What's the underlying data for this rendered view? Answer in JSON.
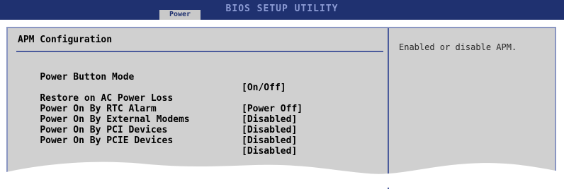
{
  "header": {
    "title": "BIOS SETUP UTILITY",
    "active_tab": "Power"
  },
  "main": {
    "section_title": "APM Configuration",
    "items": [
      {
        "label": "Power Button Mode",
        "value": "[On/Off]"
      },
      {
        "label": "Restore on AC Power Loss",
        "value": "[Power Off]"
      },
      {
        "label": "Power On By RTC Alarm",
        "value": "[Disabled]"
      },
      {
        "label": "Power On By External Modems",
        "value": "[Disabled]"
      },
      {
        "label": "Power On By PCI Devices",
        "value": "[Disabled]"
      },
      {
        "label": "Power On By PCIE Devices",
        "value": "[Disabled]"
      }
    ]
  },
  "help": {
    "text": "Enabled or disable APM."
  },
  "colors": {
    "header_bg": "#1f3170",
    "panel_bg": "#d0d0d0",
    "divider": "#4b5b9c"
  }
}
